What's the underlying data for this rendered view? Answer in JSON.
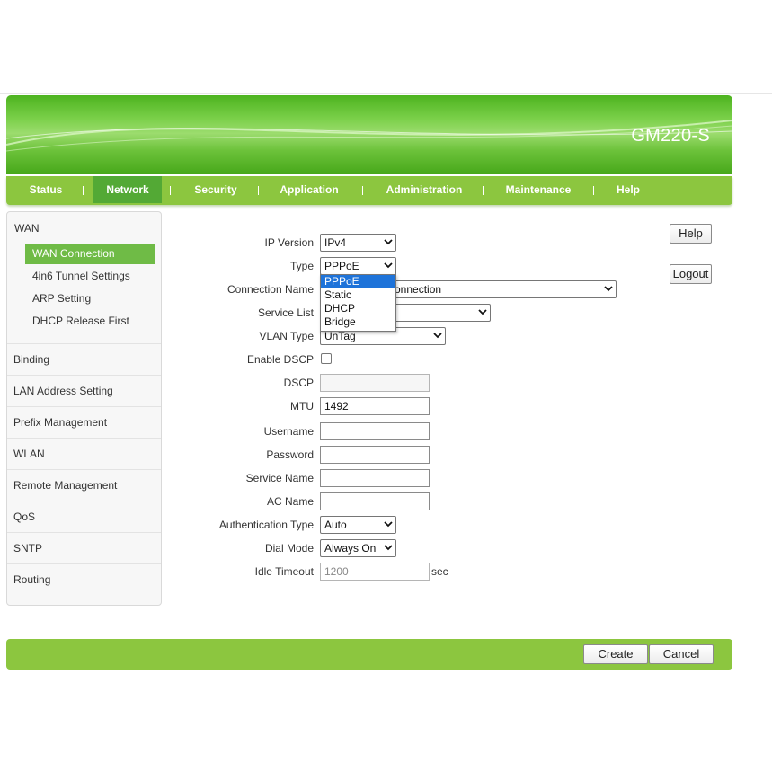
{
  "brand": "GM220-S",
  "nav": [
    {
      "label": "Status"
    },
    {
      "label": "Network"
    },
    {
      "label": "Security"
    },
    {
      "label": "Application"
    },
    {
      "label": "Administration"
    },
    {
      "label": "Maintenance"
    },
    {
      "label": "Help"
    }
  ],
  "sidebar": {
    "wan_group": "WAN",
    "wan_items": [
      "WAN Connection",
      "4in6 Tunnel Settings",
      "ARP Setting",
      "DHCP Release First"
    ],
    "items": [
      "Binding",
      "LAN Address Setting",
      "Prefix Management",
      "WLAN",
      "Remote Management",
      "QoS",
      "SNTP",
      "Routing"
    ]
  },
  "form": {
    "ip_version_label": "IP Version",
    "ip_version_value": "IPv4",
    "type_label": "Type",
    "type_value": "PPPoE",
    "type_options": [
      "PPPoE",
      "Static",
      "DHCP",
      "Bridge"
    ],
    "connection_name_label": "Connection Name",
    "connection_name_value": "onnection",
    "service_list_label": "Service List",
    "vlan_type_label": "VLAN Type",
    "vlan_type_value": "UnTag",
    "enable_dscp_label": "Enable DSCP",
    "dscp_label": "DSCP",
    "dscp_value": "",
    "mtu_label": "MTU",
    "mtu_value": "1492",
    "username_label": "Username",
    "username_value": "",
    "password_label": "Password",
    "password_value": "",
    "service_name_label": "Service Name",
    "service_name_value": "",
    "ac_name_label": "AC Name",
    "ac_name_value": "",
    "auth_type_label": "Authentication Type",
    "auth_type_value": "Auto",
    "dial_mode_label": "Dial Mode",
    "dial_mode_value": "Always On",
    "idle_timeout_label": "Idle Timeout",
    "idle_timeout_value": "1200",
    "idle_timeout_unit": "sec"
  },
  "buttons": {
    "help": "Help",
    "logout": "Logout",
    "create": "Create",
    "cancel": "Cancel"
  },
  "colors": {
    "accent": "#8cc63f",
    "active_nav": "#53a935",
    "dropdown_highlight": "#1e73d9"
  }
}
